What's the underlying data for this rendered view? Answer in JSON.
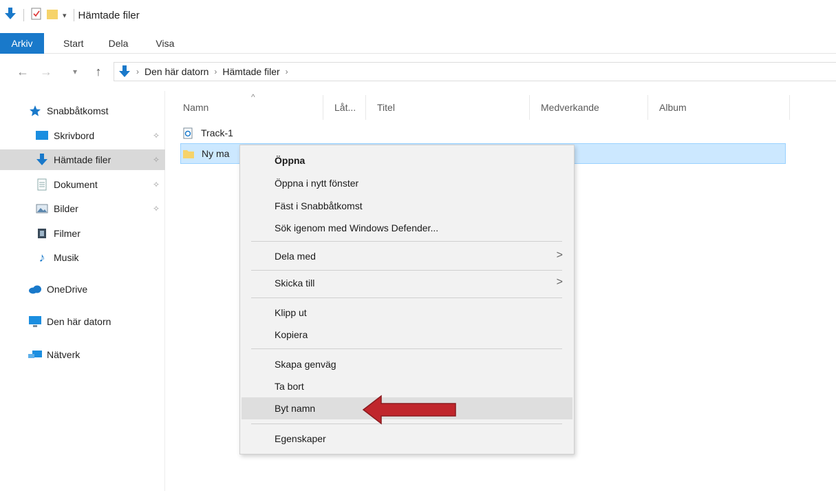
{
  "window": {
    "title": "Hämtade filer"
  },
  "ribbon": {
    "tabs": [
      "Arkiv",
      "Start",
      "Dela",
      "Visa"
    ]
  },
  "address": {
    "crumbs": [
      "Den här datorn",
      "Hämtade filer"
    ]
  },
  "navpane": {
    "items": [
      {
        "label": "Snabbåtkomst",
        "icon": "star-icon",
        "pinned": false
      },
      {
        "label": "Skrivbord",
        "icon": "desktop-icon",
        "pinned": true
      },
      {
        "label": "Hämtade filer",
        "icon": "download-arrow-icon",
        "pinned": true,
        "selected": true
      },
      {
        "label": "Dokument",
        "icon": "document-icon",
        "pinned": true
      },
      {
        "label": "Bilder",
        "icon": "pictures-icon",
        "pinned": true
      },
      {
        "label": "Filmer",
        "icon": "film-icon",
        "pinned": false
      },
      {
        "label": "Musik",
        "icon": "music-note-icon",
        "pinned": false
      },
      {
        "label": "OneDrive",
        "icon": "cloud-icon",
        "pinned": false
      },
      {
        "label": "Den här datorn",
        "icon": "computer-icon",
        "pinned": false
      },
      {
        "label": "Nätverk",
        "icon": "network-icon",
        "pinned": false
      }
    ]
  },
  "filelist": {
    "columns": [
      "Namn",
      "Låt...",
      "Titel",
      "Medverkande",
      "Album"
    ],
    "rows": [
      {
        "name": "Track-1",
        "icon": "media-file-icon",
        "selected": false
      },
      {
        "name": "Ny ma",
        "icon": "folder-icon",
        "selected": true
      }
    ]
  },
  "context_menu": {
    "items": [
      {
        "label": "Öppna",
        "bold": true
      },
      {
        "label": "Öppna i nytt fönster"
      },
      {
        "label": "Fäst i Snabbåtkomst"
      },
      {
        "label": "Sök igenom med Windows Defender..."
      },
      {
        "label": "Dela med",
        "submenu": true
      },
      {
        "label": "Skicka till",
        "submenu": true
      },
      {
        "label": "Klipp ut"
      },
      {
        "label": "Kopiera"
      },
      {
        "label": "Skapa genväg"
      },
      {
        "label": "Ta bort"
      },
      {
        "label": "Byt namn",
        "highlighted": true
      },
      {
        "label": "Egenskaper"
      }
    ]
  },
  "colors": {
    "accent": "#1979ca",
    "selection": "#cce8ff",
    "annotation_arrow": "#c0262c"
  }
}
